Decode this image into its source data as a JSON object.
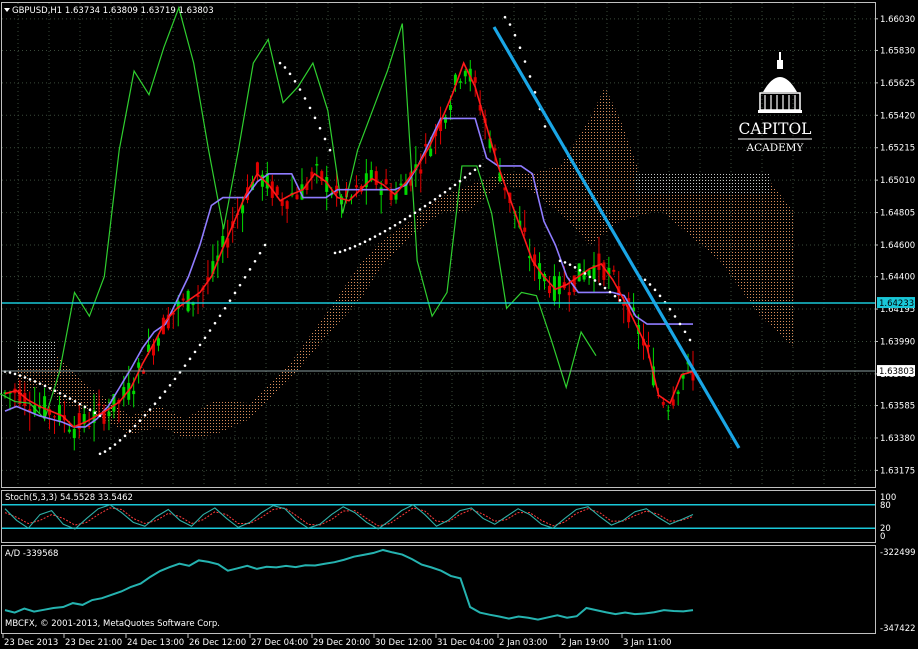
{
  "header": {
    "symbol_title": "GBPUSD,H1  1.63734 1.63809 1.63719 1.63803"
  },
  "logo": {
    "line1": "CAPITOL",
    "line2": "ACADEMY"
  },
  "footer": {
    "copyright": "MBCFX, © 2001-2013, MetaQuotes Software Corp."
  },
  "colors": {
    "background": "#000000",
    "grid": "#3a4a3a",
    "candle_up": "#00d800",
    "candle_down": "#e00000",
    "ma_red": "#ff1a1a",
    "kijun": "#8f7cff",
    "chikou": "#2fcf2f",
    "psar": "#ffffff",
    "kumo": "#d98c5a",
    "kumo_alt": "#c8c8c8",
    "trendline": "#1aa6e6",
    "hline": "#19c7d8",
    "ad_line": "#25b3b0",
    "stoch_main": "#2fb0a8",
    "stoch_signal": "#ff3a3a"
  },
  "chart_data": [
    {
      "type": "line",
      "panel": "price",
      "y_ticks": [
        "1.66030",
        "1.65830",
        "1.65625",
        "1.65420",
        "1.65215",
        "1.65010",
        "1.64805",
        "1.64600",
        "1.64400",
        "1.64195",
        "1.63990",
        "1.63785",
        "1.63585",
        "1.63380",
        "1.63175"
      ],
      "ylim": [
        1.6307,
        1.6613
      ],
      "x_ticks": [
        "23 Dec 2013",
        "23 Dec 21:00",
        "24 Dec 13:00",
        "26 Dec 12:00",
        "27 Dec 04:00",
        "29 Dec 20:00",
        "30 Dec 12:00",
        "31 Dec 04:00",
        "2 Jan 03:00",
        "2 Jan 19:00",
        "3 Jan 11:00"
      ],
      "price_labels": {
        "resistance": "1.64233",
        "current": "1.63803"
      },
      "horizontal_lines": [
        1.64233,
        1.63803
      ],
      "series": [
        {
          "values": [
            1.6366,
            1.6368,
            1.6362,
            1.6358,
            1.6355,
            1.6352,
            1.6345,
            1.6348,
            1.6352,
            1.6356,
            1.6361,
            1.637,
            1.6385,
            1.6398,
            1.6412,
            1.642,
            1.6425,
            1.643,
            1.644,
            1.6458,
            1.6475,
            1.6492,
            1.6505,
            1.6498,
            1.6488,
            1.6492,
            1.6495,
            1.6505,
            1.65,
            1.649,
            1.6488,
            1.6495,
            1.6502,
            1.6498,
            1.6492,
            1.65,
            1.651,
            1.6522,
            1.6538,
            1.6555,
            1.6575,
            1.656,
            1.6535,
            1.651,
            1.649,
            1.647,
            1.645,
            1.644,
            1.6432,
            1.6435,
            1.644,
            1.6445,
            1.6448,
            1.6438,
            1.6425,
            1.641,
            1.6395,
            1.6365,
            1.636,
            1.6378,
            1.638
          ]
        },
        {
          "values": [
            1.6355,
            1.6358,
            1.6355,
            1.6352,
            1.635,
            1.6348,
            1.6345,
            1.6345,
            1.635,
            1.6358,
            1.637,
            1.6382,
            1.6395,
            1.6405,
            1.641,
            1.6425,
            1.644,
            1.646,
            1.6485,
            1.649,
            1.649,
            1.649,
            1.65,
            1.6505,
            1.6505,
            1.6505,
            1.649,
            1.649,
            1.649,
            1.6495,
            1.6495,
            1.6495,
            1.6495,
            1.6495,
            1.6495,
            1.6498,
            1.651,
            1.6525,
            1.654,
            1.654,
            1.654,
            1.654,
            1.6515,
            1.651,
            1.651,
            1.651,
            1.6505,
            1.6475,
            1.646,
            1.644,
            1.643,
            1.643,
            1.643,
            1.643,
            1.6428,
            1.6415,
            1.641,
            1.641,
            1.641,
            1.641,
            1.641
          ]
        },
        {
          "values": [
            1.6366,
            1.6361,
            1.636,
            1.635,
            1.638,
            1.643,
            1.6415,
            1.644,
            1.652,
            1.657,
            1.6555,
            1.6585,
            1.661,
            1.6575,
            1.652,
            1.647,
            1.652,
            1.6575,
            1.659,
            1.655,
            1.656,
            1.6575,
            1.6545,
            1.648,
            1.652,
            1.6545,
            1.657,
            1.66,
            1.645,
            1.6415,
            1.643,
            1.651,
            1.651,
            1.648,
            1.642,
            1.643,
            1.6428,
            1.64,
            1.637,
            1.6405,
            1.639
          ]
        }
      ]
    },
    {
      "type": "line",
      "panel": "stochastic",
      "title": "Stoch(5,3,3) 54.5528 33.5462",
      "y_ticks": [
        "100",
        "80",
        "20",
        "0"
      ],
      "ylim": [
        0,
        100
      ],
      "levels": [
        80,
        20
      ],
      "series": [
        {
          "values": [
            70,
            40,
            20,
            55,
            65,
            30,
            18,
            45,
            70,
            80,
            60,
            35,
            25,
            50,
            68,
            40,
            25,
            55,
            72,
            45,
            22,
            35,
            60,
            78,
            70,
            40,
            20,
            30,
            55,
            75,
            60,
            35,
            18,
            40,
            65,
            80,
            55,
            25,
            40,
            65,
            72,
            45,
            30,
            50,
            70,
            55,
            30,
            20,
            45,
            68,
            75,
            50,
            28,
            40,
            62,
            70,
            48,
            30,
            42,
            55
          ]
        },
        {
          "values": [
            60,
            48,
            32,
            40,
            55,
            45,
            28,
            35,
            55,
            72,
            68,
            45,
            32,
            40,
            58,
            50,
            32,
            42,
            62,
            55,
            32,
            32,
            48,
            68,
            72,
            52,
            30,
            28,
            42,
            64,
            65,
            45,
            26,
            32,
            52,
            72,
            64,
            38,
            36,
            55,
            68,
            56,
            38,
            42,
            60,
            60,
            40,
            26,
            36,
            58,
            70,
            60,
            38,
            38,
            52,
            64,
            56,
            38,
            40,
            50
          ]
        }
      ]
    },
    {
      "type": "line",
      "panel": "A/D",
      "title": "A/D -339568",
      "y_ticks": [
        "-322499",
        "-347422"
      ],
      "ylim": [
        -349000,
        -320500
      ],
      "series": [
        {
          "values": [
            -341500,
            -342300,
            -341000,
            -342000,
            -341400,
            -340800,
            -340500,
            -339200,
            -339800,
            -338200,
            -337600,
            -336500,
            -335400,
            -333900,
            -332800,
            -330600,
            -328700,
            -327400,
            -326300,
            -327000,
            -325200,
            -325700,
            -326500,
            -328600,
            -327800,
            -327000,
            -328000,
            -327300,
            -327500,
            -327000,
            -327400,
            -326800,
            -326900,
            -326300,
            -325800,
            -325000,
            -324000,
            -323400,
            -322800,
            -321800,
            -322600,
            -323300,
            -324800,
            -326600,
            -327500,
            -328600,
            -330300,
            -331100,
            -340500,
            -342300,
            -343000,
            -343600,
            -344300,
            -343600,
            -344000,
            -344600,
            -343900,
            -343200,
            -344000,
            -343500,
            -340800,
            -341500,
            -342200,
            -342800,
            -342300,
            -342800,
            -342600,
            -342200,
            -341500,
            -341800,
            -341900,
            -341500
          ]
        }
      ]
    }
  ]
}
